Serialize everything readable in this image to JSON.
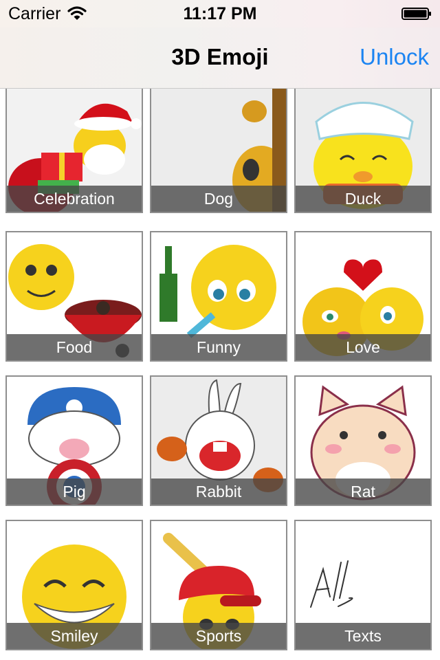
{
  "status_bar": {
    "carrier": "Carrier",
    "time": "11:17 PM"
  },
  "nav": {
    "title": "3D Emoji",
    "action": "Unlock"
  },
  "categories": [
    {
      "label": "Celebration",
      "icon": "santa-emoji-icon"
    },
    {
      "label": "Dog",
      "icon": "dog-emoji-icon"
    },
    {
      "label": "Duck",
      "icon": "duck-chef-emoji-icon"
    },
    {
      "label": "Food",
      "icon": "barbecue-emoji-icon"
    },
    {
      "label": "Funny",
      "icon": "drunk-emoji-icon"
    },
    {
      "label": "Love",
      "icon": "kissing-couple-emoji-icon"
    },
    {
      "label": "Pig",
      "icon": "captain-pig-emoji-icon"
    },
    {
      "label": "Rabbit",
      "icon": "rabbit-emoji-icon"
    },
    {
      "label": "Rat",
      "icon": "cat-emoji-icon"
    },
    {
      "label": "Smiley",
      "icon": "grin-emoji-icon"
    },
    {
      "label": "Sports",
      "icon": "baseball-emoji-icon"
    },
    {
      "label": "Texts",
      "icon": "signature-text-icon"
    }
  ]
}
